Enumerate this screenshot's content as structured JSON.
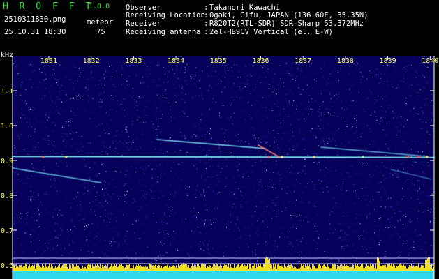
{
  "app": {
    "name": "H R O F F T",
    "version": "1.0.0"
  },
  "file": {
    "name": "2510311830.png",
    "datetime": "25.10.31 18:30"
  },
  "meteor": {
    "label": "meteor",
    "count": "75"
  },
  "info": [
    {
      "label": "Observer",
      "value": "Takanori Kawachi"
    },
    {
      "label": "Receiving Location",
      "value": "Ogaki, Gifu, JAPAN (136.60E, 35.35N)"
    },
    {
      "label": "Receiver",
      "value": "R820T2(RTL-SDR) SDR-Sharp 53.372MHz"
    },
    {
      "label": "Receiving antenna",
      "value": "2el-HB9CV Vertical (el. E-W)"
    }
  ],
  "colors": {
    "accent": "#30e030",
    "text": "#ffffff",
    "tick_text": "#ffff60",
    "background": "#06005a"
  },
  "spectrogram": {
    "y_unit": "kHz",
    "y_ticks": [
      "1.1",
      "1.0",
      "0.9",
      "0.8",
      "0.7",
      "0.6"
    ],
    "y_values": [
      1.1,
      1.0,
      0.9,
      0.8,
      0.7,
      0.6
    ],
    "x_ticks": [
      "1831",
      "1832",
      "1833",
      "1834",
      "1835",
      "1836",
      "1837",
      "1838",
      "1839",
      "1840"
    ],
    "x_values": [
      1831,
      1832,
      1833,
      1834,
      1835,
      1836,
      1837,
      1838,
      1839,
      1840
    ]
  }
}
